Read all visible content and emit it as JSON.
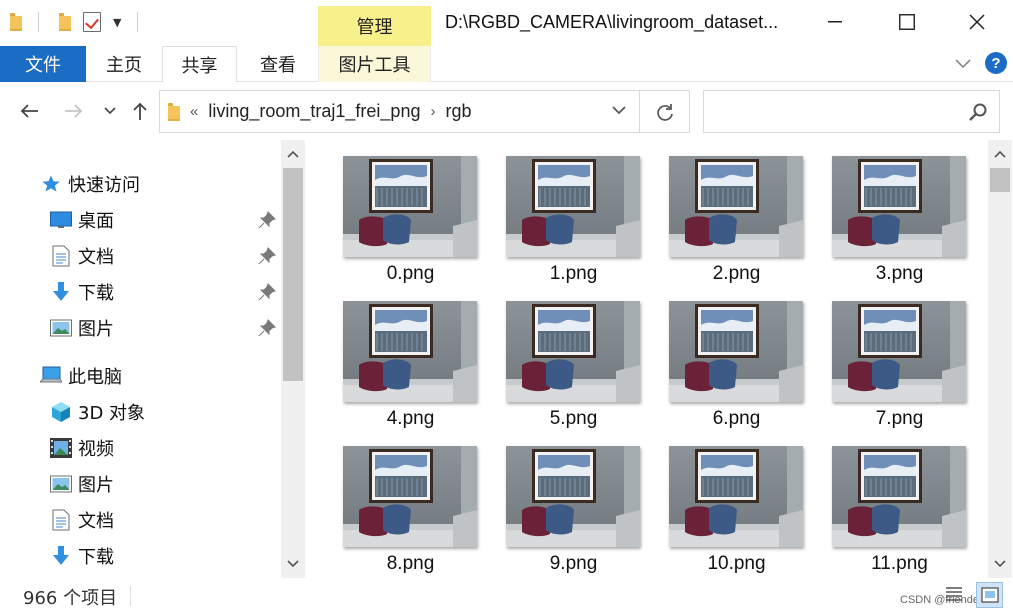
{
  "window": {
    "title": "D:\\RGBD_CAMERA\\livingroom_dataset...",
    "manage_tab": "管理",
    "minimize": "—",
    "maximize": "☐",
    "close": "✕"
  },
  "ribbon": {
    "tabs": [
      "文件",
      "主页",
      "共享",
      "查看",
      "图片工具"
    ]
  },
  "address": {
    "overflow": "«",
    "crumbs": [
      "living_room_traj1_frei_png",
      "rgb"
    ],
    "search_placeholder": ""
  },
  "nav": {
    "quick_access": {
      "label": "快速访问",
      "items": [
        {
          "label": "桌面",
          "icon": "desktop-icon",
          "pinned": true
        },
        {
          "label": "文档",
          "icon": "document-icon",
          "pinned": true
        },
        {
          "label": "下载",
          "icon": "download-icon",
          "pinned": true
        },
        {
          "label": "图片",
          "icon": "pictures-icon",
          "pinned": true
        }
      ]
    },
    "this_pc": {
      "label": "此电脑",
      "items": [
        {
          "label": "3D 对象",
          "icon": "3d-objects-icon"
        },
        {
          "label": "视频",
          "icon": "video-icon"
        },
        {
          "label": "图片",
          "icon": "pictures-icon"
        },
        {
          "label": "文档",
          "icon": "document-icon"
        },
        {
          "label": "下载",
          "icon": "download-icon"
        }
      ]
    }
  },
  "files": [
    "0.png",
    "1.png",
    "2.png",
    "3.png",
    "4.png",
    "5.png",
    "6.png",
    "7.png",
    "8.png",
    "9.png",
    "10.png",
    "11.png"
  ],
  "status": {
    "count": "966 个项目",
    "watermark": "CSDN @friendew"
  },
  "colors": {
    "accent": "#1a6cc4",
    "manage_tab": "#f8f08a",
    "tools_tab": "#fbf8d9"
  }
}
